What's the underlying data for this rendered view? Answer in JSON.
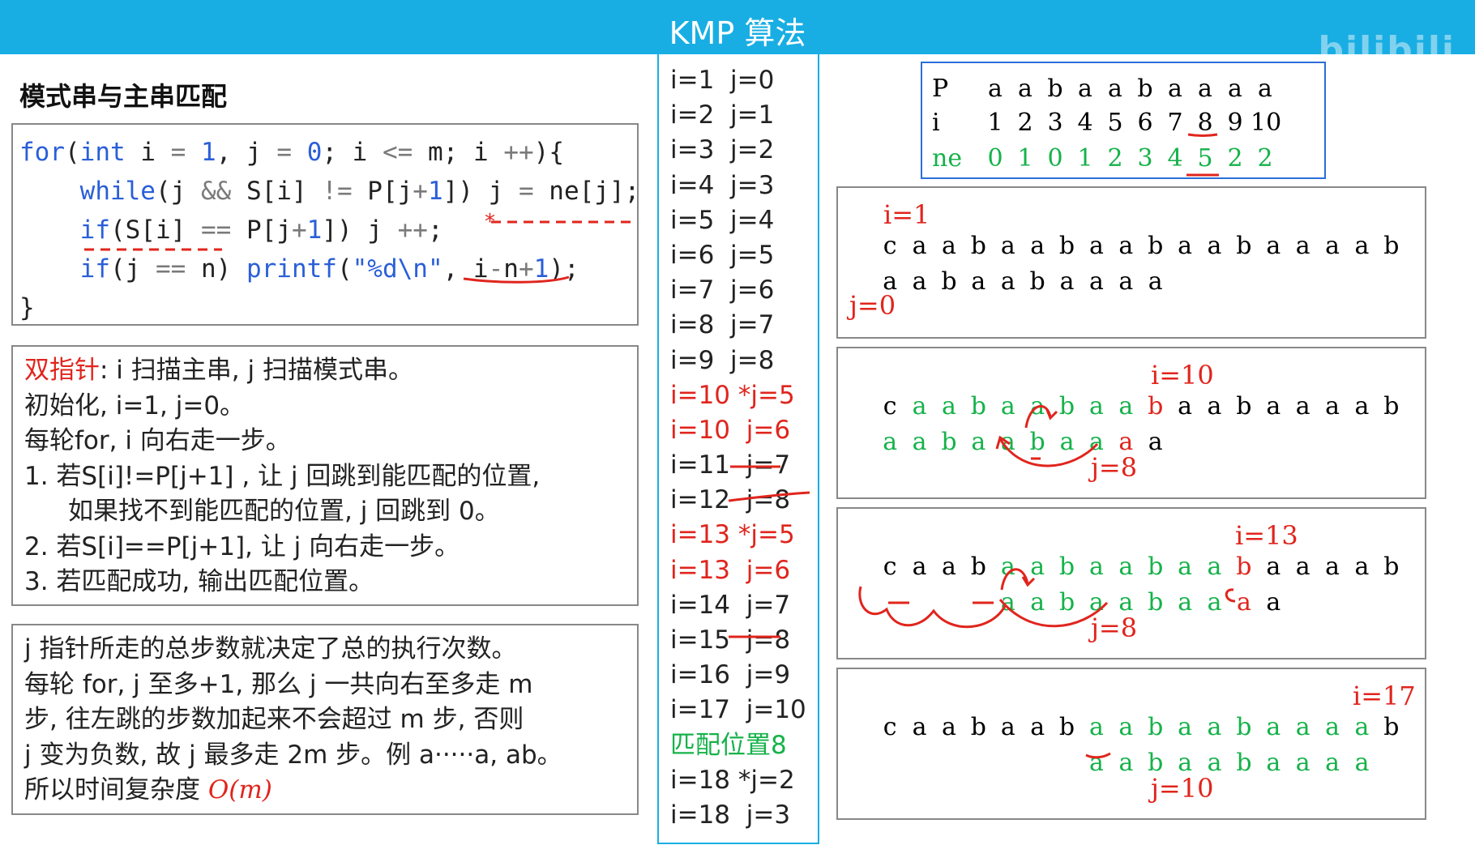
{
  "header": {
    "title": "KMP 算法",
    "watermark": "bilibili"
  },
  "left": {
    "section_title": "模式串与主串匹配",
    "code": {
      "l1": {
        "kw": "for",
        "p1": "(",
        "int": "int",
        "p2": " i ",
        "op1": "=",
        "p3": " ",
        "n1": "1",
        "p4": ", j ",
        "op2": "=",
        "p5": " ",
        "n2": "0",
        "p6": "; i ",
        "op3": "<=",
        "p7": " m; i ",
        "op4": "++",
        "p8": "){"
      },
      "l2": {
        "ind": "    ",
        "kw": "while",
        "p1": "(j ",
        "op1": "&&",
        "p2": " S[i] ",
        "op2": "!=",
        "p3": " P[j",
        "op3": "+",
        "n1": "1",
        "p4": "]) j ",
        "op4": "=",
        "p5": " ne[j];"
      },
      "l3": {
        "ind": "    ",
        "kw": "if",
        "p1": "(S[i] ",
        "op1": "==",
        "p2": " P[j",
        "op2": "+",
        "n1": "1",
        "p3": "]) j ",
        "op3": "++",
        "p4": ";"
      },
      "l4": {
        "ind": "    ",
        "kw": "if",
        "p1": "(j ",
        "op1": "==",
        "p2": " n) ",
        "fn": "printf",
        "p3": "(",
        "s": "\"%d\\n\"",
        "p4": ", i",
        "op2": "-",
        "p5": "n",
        "op3": "+",
        "n1": "1",
        "p6": ");"
      },
      "l5": "}"
    },
    "desc": {
      "l1_red": "双指针",
      "l1_rest": ": i 扫描主串, j 扫描模式串。",
      "l2": "初始化, i=1, j=0。",
      "l3": "每轮for, i 向右走一步。",
      "l4": "1.   若S[i]!=P[j+1] ,   让 j 回跳到能匹配的位置,",
      "l5": "如果找不到能匹配的位置,   j 回跳到 0。",
      "l6": "2.   若S[i]==P[j+1], 让 j 向右走一步。",
      "l7": "3.   若匹配成功, 输出匹配位置。"
    },
    "complexity": {
      "l1": "j 指针所走的总步数就决定了总的执行次数。",
      "l2": "每轮 for, j 至多+1, 那么 j 一共向右至多走 m",
      "l3": "步, 往左跳的步数加起来不会超过 m 步, 否则",
      "l4": "j 变为负数, 故 j 最多走 2m 步。例 a·····a, ab。",
      "l5_pre": "所以时间复杂度 ",
      "l5_red": "O(m)"
    }
  },
  "trace": [
    {
      "text": "i=1  j=0",
      "color": "black"
    },
    {
      "text": "i=2  j=1",
      "color": "black"
    },
    {
      "text": "i=3  j=2",
      "color": "black"
    },
    {
      "text": "i=4  j=3",
      "color": "black"
    },
    {
      "text": "i=5  j=4",
      "color": "black"
    },
    {
      "text": "i=6  j=5",
      "color": "black"
    },
    {
      "text": "i=7  j=6",
      "color": "black"
    },
    {
      "text": "i=8  j=7",
      "color": "black"
    },
    {
      "text": "i=9  j=8",
      "color": "black"
    },
    {
      "text": "i=10 *j=5",
      "color": "red"
    },
    {
      "text": "i=10  j=6",
      "color": "red"
    },
    {
      "text": "i=11  j=7",
      "color": "black"
    },
    {
      "text": "i=12  j=8",
      "color": "black"
    },
    {
      "text": "i=13 *j=5",
      "color": "red"
    },
    {
      "text": "i=13  j=6",
      "color": "red"
    },
    {
      "text": "i=14  j=7",
      "color": "black"
    },
    {
      "text": "i=15  j=8",
      "color": "black"
    },
    {
      "text": "i=16  j=9",
      "color": "black"
    },
    {
      "text": "i=17  j=10",
      "color": "black"
    },
    {
      "text": "匹配位置8",
      "color": "green"
    },
    {
      "text": "i=18 *j=2",
      "color": "black"
    },
    {
      "text": "i=18  j=3",
      "color": "black"
    }
  ],
  "ptable": {
    "p_label": "P",
    "i_label": "i",
    "ne_label": "ne",
    "p": [
      "a",
      "a",
      "b",
      "a",
      "a",
      "b",
      "a",
      "a",
      "a",
      "a"
    ],
    "i": [
      "1",
      "2",
      "3",
      "4",
      "5",
      "6",
      "7",
      "8",
      "9",
      "10"
    ],
    "ne": [
      "0",
      "1",
      "0",
      "1",
      "2",
      "3",
      "4",
      "5",
      "2",
      "2"
    ]
  },
  "steps": [
    {
      "i_label": "i=1",
      "j_label": "j=0",
      "main": "caabaabaabaabaaaab",
      "main_green": [],
      "main_red": [],
      "pat": "aabaabaaaa",
      "pat_green": [],
      "pat_red": []
    },
    {
      "i_label": "i=10",
      "j_label": "j=8",
      "main": "caabaabaabaabaaaab",
      "main_green": [
        1,
        2,
        3,
        4,
        5,
        6,
        7,
        8
      ],
      "main_red": [
        9
      ],
      "pat": "aabaabaaaa",
      "pat_green": [
        0,
        1,
        2,
        3,
        4,
        5,
        6,
        7
      ],
      "pat_red": [
        8
      ]
    },
    {
      "i_label": "i=13",
      "j_label": "j=8",
      "main": "caabaabaabaabaaaab",
      "main_green": [
        4,
        5,
        6,
        7,
        8,
        9,
        10,
        11
      ],
      "main_red": [
        12
      ],
      "pat": "aabaabaaaa",
      "pat_green": [
        0,
        1,
        2,
        3,
        4,
        5,
        6,
        7
      ],
      "pat_red": [
        8
      ]
    },
    {
      "i_label": "i=17",
      "j_label": "j=10",
      "main": "caabaabaabaabaaaab",
      "main_green": [
        7,
        8,
        9,
        10,
        11,
        12,
        13,
        14,
        15,
        16
      ],
      "main_red": [],
      "pat": "aabaabaaaa",
      "pat_green": [
        0,
        1,
        2,
        3,
        4,
        5,
        6,
        7,
        8,
        9
      ],
      "pat_red": []
    }
  ]
}
